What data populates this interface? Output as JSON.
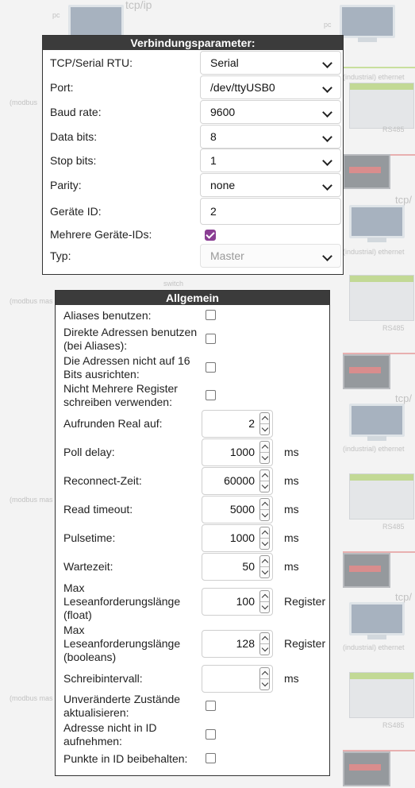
{
  "background": {
    "texts": [
      "tcp/ip",
      "pc",
      "pc",
      "(industrial) ethernet",
      "RS485",
      "tcp/",
      "(modbus",
      "(modbus mas",
      "switch",
      "(industrial) ethernet",
      "RS485",
      "tcp/",
      "(industrial) ethernet",
      "RS485",
      "tcp/",
      "(modbus mas",
      "(industrial) ethernet",
      "RS485",
      "(modbus mas"
    ]
  },
  "connection": {
    "title": "Verbindungsparameter:",
    "fields": [
      {
        "label": "TCP/Serial RTU:",
        "value": "Serial"
      },
      {
        "label": "Port:",
        "value": "/dev/ttyUSB0"
      },
      {
        "label": "Baud rate:",
        "value": "9600"
      },
      {
        "label": "Data bits:",
        "value": "8"
      },
      {
        "label": "Stop bits:",
        "value": "1"
      },
      {
        "label": "Parity:",
        "value": "none"
      }
    ],
    "device_id": {
      "label": "Geräte ID:",
      "value": "2"
    },
    "multi_ids": {
      "label": "Mehrere Geräte-IDs:",
      "checked": true
    },
    "type": {
      "label": "Typ:",
      "value": "Master"
    },
    "accent_color": "#8a3e93"
  },
  "general": {
    "title": "Allgemein",
    "checks_top": [
      {
        "label": "Aliases benutzen:",
        "checked": false
      },
      {
        "label": "Direkte Adressen benutzen (bei Aliases):",
        "checked": false
      },
      {
        "label": "Die Adressen nicht auf 16 Bits ausrichten:",
        "checked": false
      },
      {
        "label": "Nicht Mehrere Register schreiben verwenden:",
        "checked": false
      }
    ],
    "numbers": [
      {
        "label": "Aufrunden Real auf:",
        "value": "2",
        "unit": ""
      },
      {
        "label": "Poll delay:",
        "value": "1000",
        "unit": "ms"
      },
      {
        "label": "Reconnect-Zeit:",
        "value": "60000",
        "unit": "ms"
      },
      {
        "label": "Read timeout:",
        "value": "5000",
        "unit": "ms"
      },
      {
        "label": "Pulsetime:",
        "value": "1000",
        "unit": "ms"
      },
      {
        "label": "Wartezeit:",
        "value": "50",
        "unit": "ms"
      },
      {
        "label": "Max Leseanforderungslänge (float)",
        "value": "100",
        "unit": "Register"
      },
      {
        "label": "Max Leseanforderungslänge (booleans)",
        "value": "128",
        "unit": "Register"
      },
      {
        "label": "Schreibintervall:",
        "value": "",
        "unit": "ms"
      }
    ],
    "checks_bottom": [
      {
        "label": "Unveränderte Zustände aktualisieren:",
        "checked": false
      },
      {
        "label": "Adresse nicht in ID aufnehmen:",
        "checked": false
      },
      {
        "label": "Punkte in ID beibehalten:",
        "checked": false
      }
    ]
  }
}
